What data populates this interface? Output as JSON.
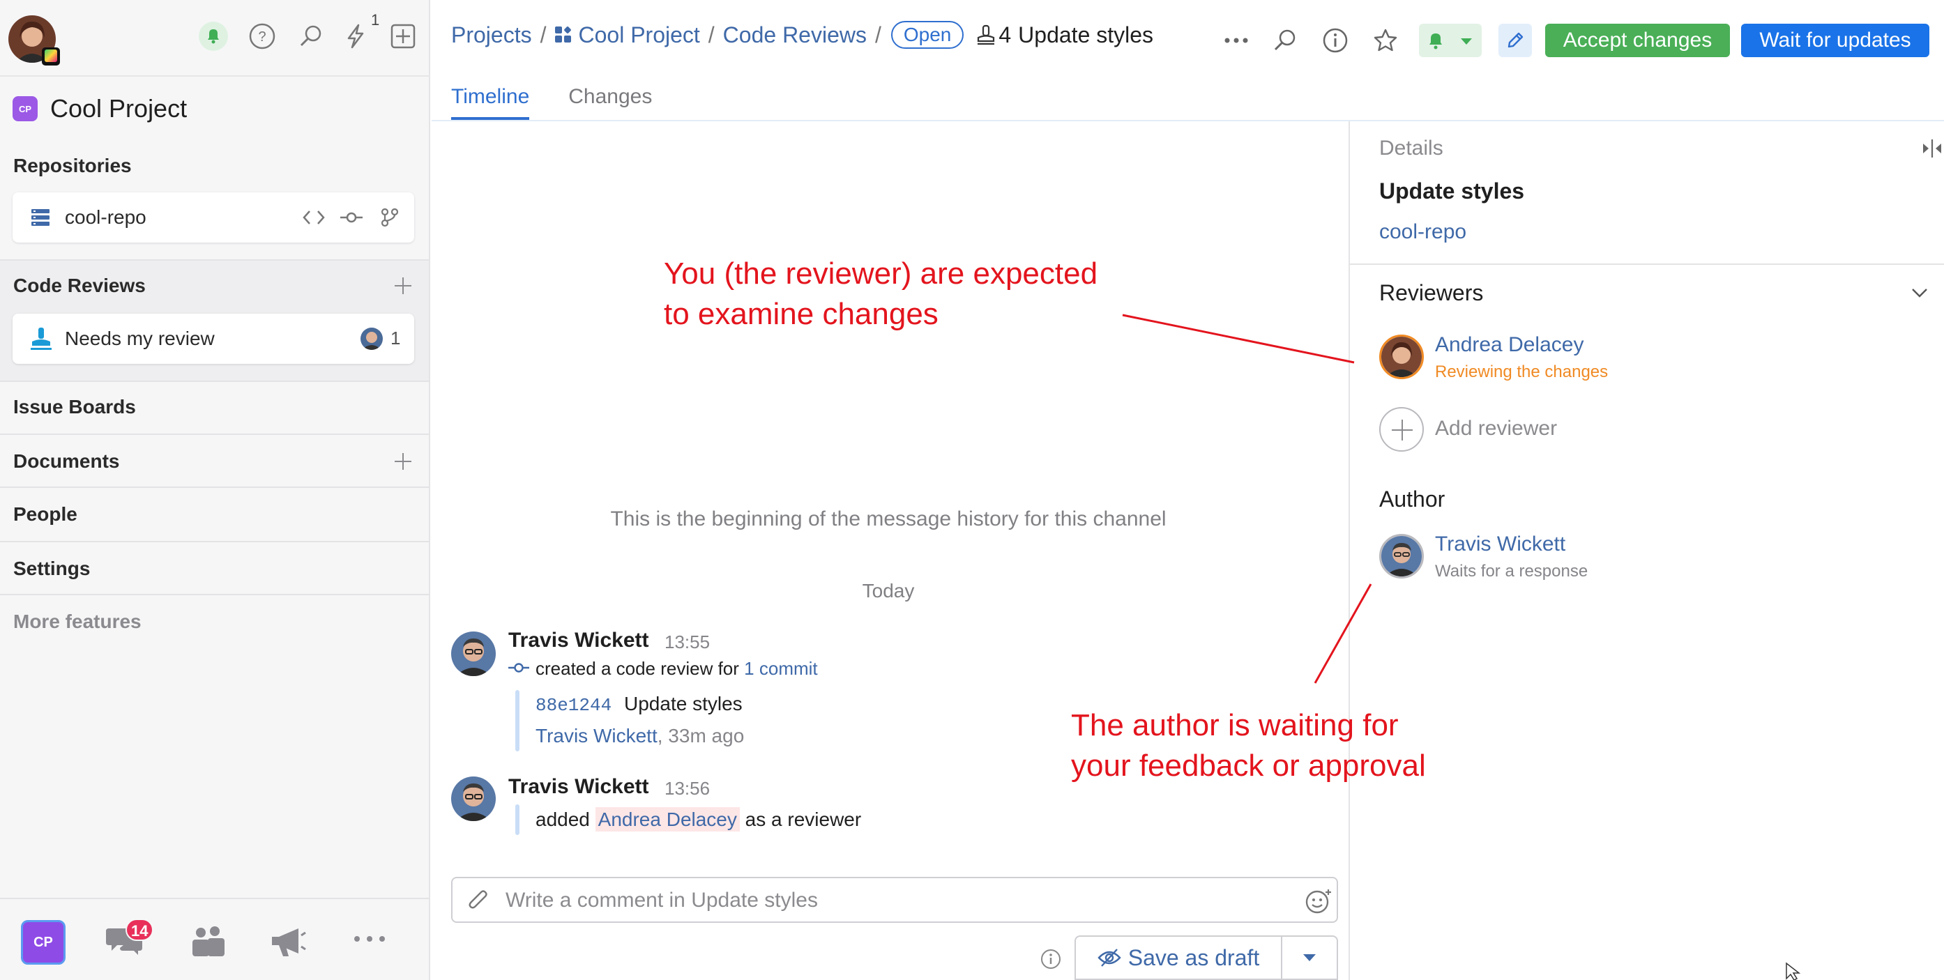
{
  "sidebar": {
    "notification_count": "1",
    "project": {
      "badge": "CP",
      "name": "Cool Project"
    },
    "repositories": {
      "title": "Repositories",
      "repo_name": "cool-repo"
    },
    "code_reviews": {
      "title": "Code Reviews",
      "item_label": "Needs my review",
      "item_count": "1"
    },
    "nav": {
      "issue_boards": "Issue Boards",
      "documents": "Documents",
      "people": "People",
      "settings": "Settings",
      "more_features": "More features"
    },
    "bottom": {
      "project_badge": "CP",
      "chat_badge": "14"
    }
  },
  "header": {
    "breadcrumb": {
      "projects": "Projects",
      "project": "Cool Project",
      "code_reviews": "Code Reviews",
      "sep": "/"
    },
    "status": "Open",
    "review_number": "4",
    "review_title": "Update styles",
    "accept_label": "Accept changes",
    "wait_label": "Wait for updates",
    "colors": {
      "accept": "#4aaf57",
      "wait": "#1a73e8",
      "link": "#3f69a8"
    }
  },
  "tabs": [
    "Timeline",
    "Changes"
  ],
  "timeline": {
    "history_note": "This is the beginning of the message history for this channel",
    "day_label": "Today",
    "messages": [
      {
        "author": "Travis Wickett",
        "time": "13:55",
        "action_prefix": "created a code review for",
        "action_link": "1 commit",
        "commit_hash": "88e1244",
        "commit_title": "Update styles",
        "commit_author": "Travis Wickett",
        "commit_age": ", 33m ago"
      },
      {
        "author": "Travis Wickett",
        "time": "13:56",
        "text_prefix": "added",
        "mention": "Andrea Delacey",
        "text_suffix": "as a reviewer"
      }
    ],
    "composer_placeholder": "Write a comment in Update styles",
    "save_draft_label": "Save as draft"
  },
  "details": {
    "heading": "Details",
    "title": "Update styles",
    "repo": "cool-repo",
    "reviewers_title": "Reviewers",
    "reviewer": {
      "name": "Andrea Delacey",
      "status": "Reviewing the changes",
      "status_color": "#f08a24"
    },
    "add_reviewer": "Add reviewer",
    "author_title": "Author",
    "author": {
      "name": "Travis Wickett",
      "status": "Waits for a response"
    }
  },
  "annotations": {
    "reviewer_note": "You (the reviewer) are expected\nto examine changes",
    "author_note": "The author is waiting for\nyour feedback or approval",
    "color": "#e3141d"
  }
}
